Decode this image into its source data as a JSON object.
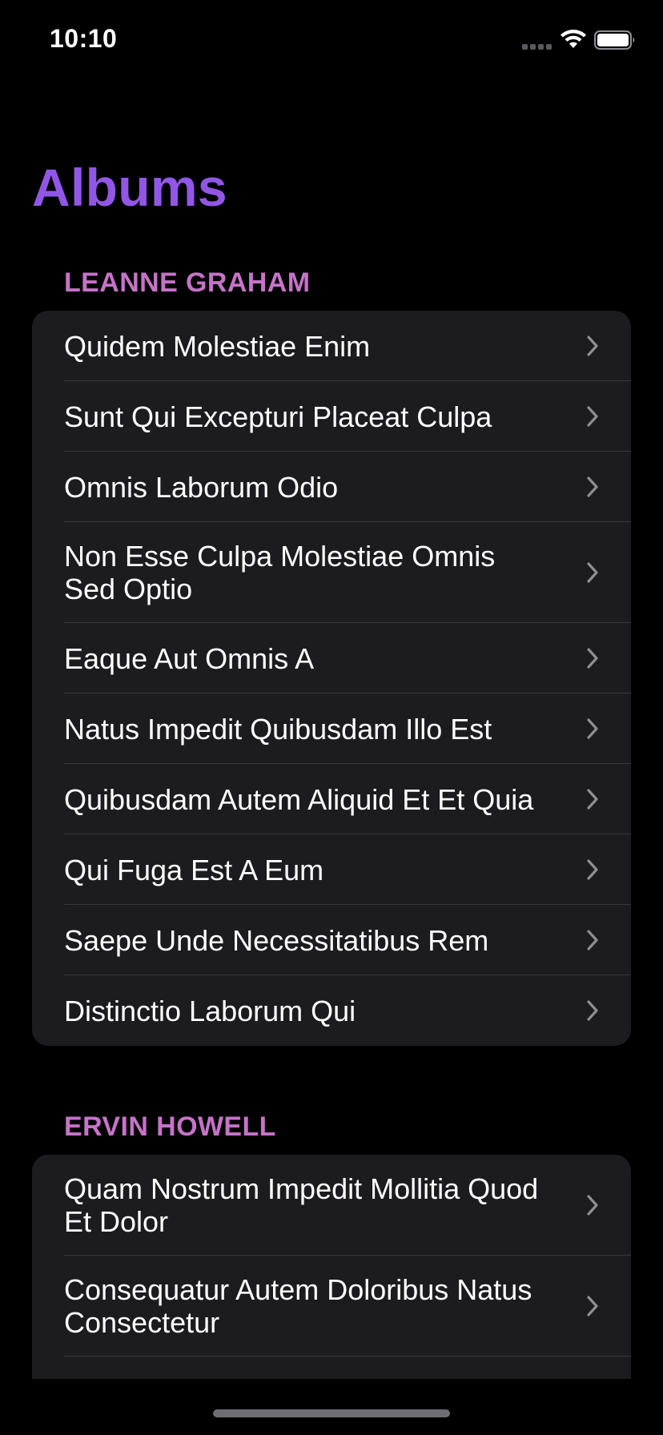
{
  "status_bar": {
    "time": "10:10"
  },
  "nav": {
    "title": "Albums"
  },
  "sections": [
    {
      "header": "LEANNE GRAHAM",
      "items": [
        {
          "label": "Quidem Molestiae Enim"
        },
        {
          "label": "Sunt Qui Excepturi Placeat Culpa"
        },
        {
          "label": "Omnis Laborum Odio"
        },
        {
          "label": "Non Esse Culpa Molestiae Omnis Sed Optio"
        },
        {
          "label": "Eaque Aut Omnis A"
        },
        {
          "label": "Natus Impedit Quibusdam Illo Est"
        },
        {
          "label": "Quibusdam Autem Aliquid Et Et Quia"
        },
        {
          "label": "Qui Fuga Est A Eum"
        },
        {
          "label": "Saepe Unde Necessitatibus Rem"
        },
        {
          "label": "Distinctio Laborum Qui"
        }
      ]
    },
    {
      "header": "ERVIN HOWELL",
      "items": [
        {
          "label": "Quam Nostrum Impedit Mollitia Quod Et Dolor"
        },
        {
          "label": "Consequatur Autem Doloribus Natus Consectetur"
        }
      ]
    }
  ],
  "icons": {
    "signal": "cellular-signal-icon",
    "wifi": "wifi-icon",
    "battery": "battery-icon",
    "chevron": "chevron-right-icon"
  },
  "colors": {
    "background": "#000000",
    "title": "#9156e6",
    "section_header": "#c573c7",
    "cell_background": "#1c1c1e",
    "separator": "#38383a",
    "chevron": "#8e8e93"
  }
}
